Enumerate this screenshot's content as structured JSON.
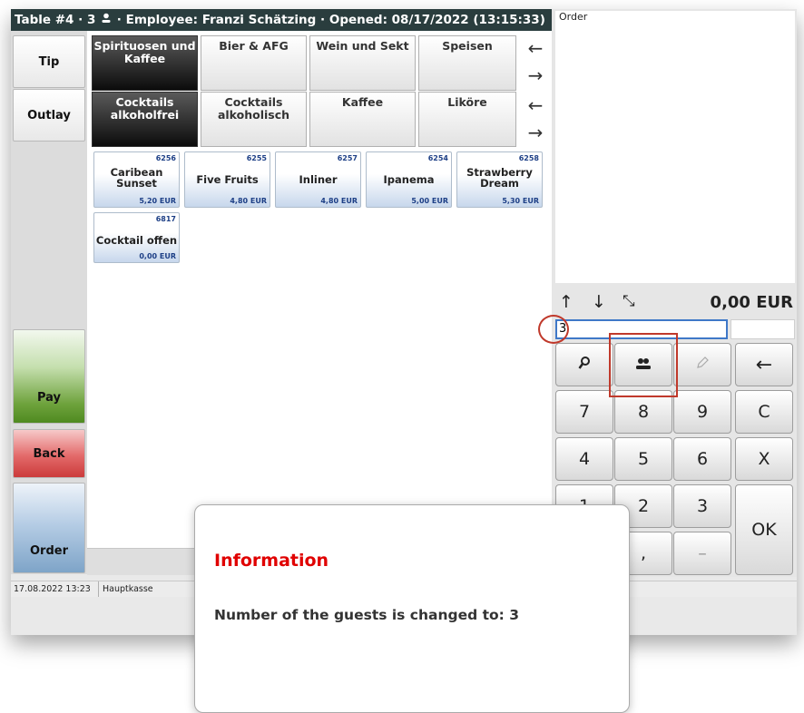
{
  "title_bar": {
    "table": "Table #4",
    "guests": "3",
    "employee": "Employee: Franzi Schätzing",
    "opened": "Opened: 08/17/2022 (13:15:33)",
    "separator": "·"
  },
  "left_buttons": {
    "tip": "Tip",
    "outlay": "Outlay",
    "pay": "Pay",
    "back": "Back",
    "order": "Order"
  },
  "categories_row1": [
    {
      "label": "Spirituosen und Kaffee",
      "selected": true
    },
    {
      "label": "Bier & AFG",
      "selected": false
    },
    {
      "label": "Wein und Sekt",
      "selected": false
    },
    {
      "label": "Speisen",
      "selected": false
    }
  ],
  "categories_row2": [
    {
      "label": "Cocktails alkoholfrei",
      "selected": true
    },
    {
      "label": "Cocktails alkoholisch",
      "selected": false
    },
    {
      "label": "Kaffee",
      "selected": false
    },
    {
      "label": "Liköre",
      "selected": false
    }
  ],
  "arrows": {
    "left": "←",
    "right": "→"
  },
  "products": [
    {
      "id": "6256",
      "name": "Caribean Sunset",
      "price": "5,20 EUR"
    },
    {
      "id": "6255",
      "name": "Five Fruits",
      "price": "4,80 EUR"
    },
    {
      "id": "6257",
      "name": "Inliner",
      "price": "4,80 EUR"
    },
    {
      "id": "6254",
      "name": "Ipanema",
      "price": "5,00 EUR"
    },
    {
      "id": "6258",
      "name": "Strawberry Dream",
      "price": "5,30 EUR"
    },
    {
      "id": "6817",
      "name": "Cocktail offen",
      "price": "0,00 EUR"
    }
  ],
  "order_panel": {
    "title": "Order",
    "total": "0,00 EUR",
    "up_icon": "↑",
    "down_icon": "↓",
    "expand_icon": "⤡"
  },
  "input": {
    "value": "3"
  },
  "keypad": {
    "search_icon": "search-icon",
    "guests_icon": "guests-icon",
    "edit_icon": "edit-icon",
    "backspace": "←",
    "keys": [
      "7",
      "8",
      "9",
      "C",
      "4",
      "5",
      "6",
      "X",
      "1",
      "2",
      "3"
    ],
    "comma": ",",
    "minus": "–",
    "ok": "OK"
  },
  "status_bar": {
    "datetime": "17.08.2022 13:23",
    "register": "Hauptkasse"
  },
  "dialog": {
    "title": "Information",
    "message": "Number of the guests is changed to: 3"
  },
  "colors": {
    "title_bar_bg": "#2a3d3e",
    "dialog_title": "#e00000",
    "highlight_red": "#c0392b",
    "price_blue": "#1d3f86"
  }
}
